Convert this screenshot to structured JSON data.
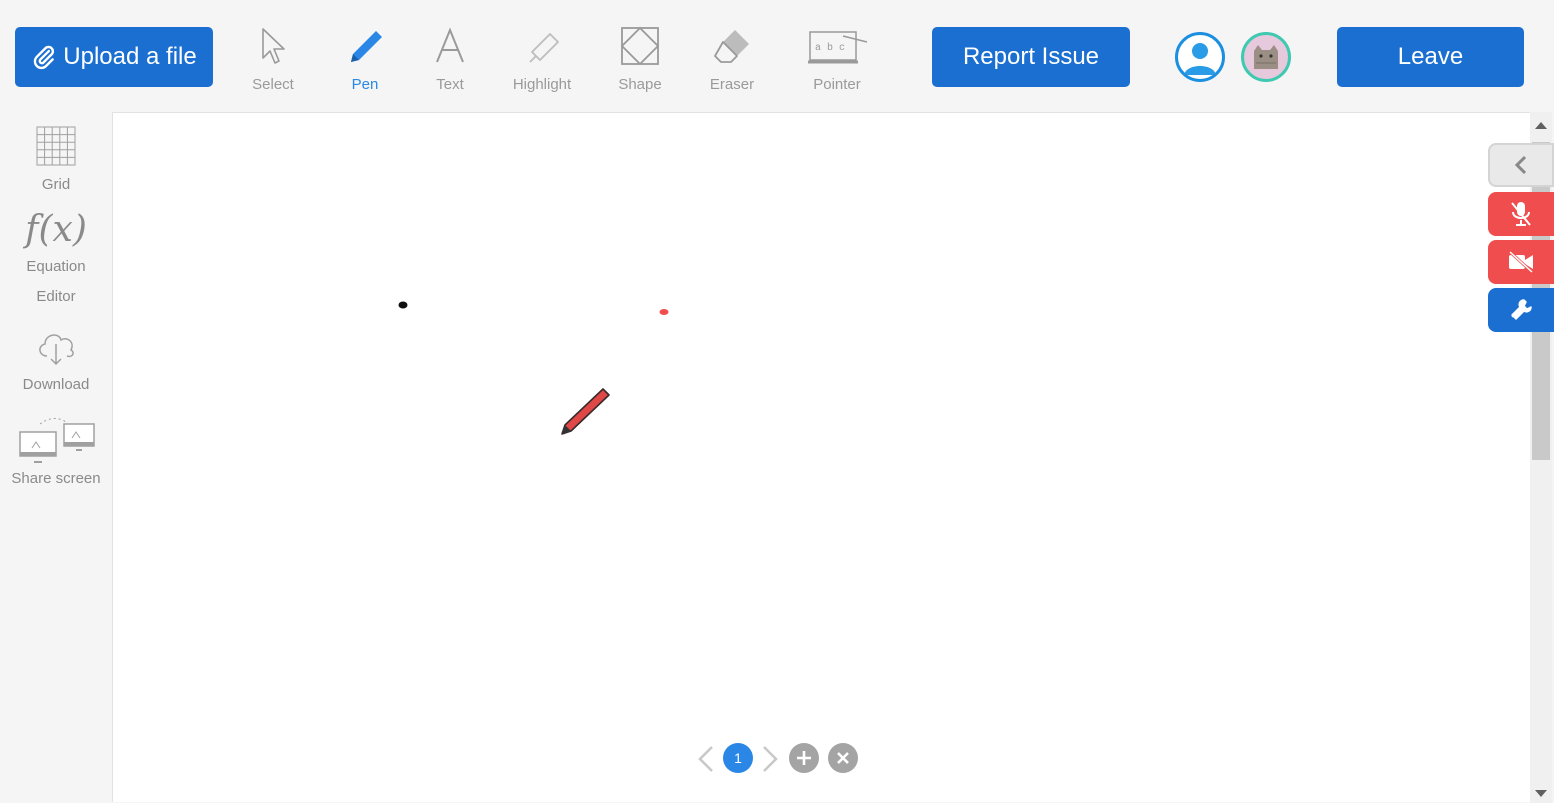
{
  "toolbar": {
    "upload_label": "Upload a file",
    "tools": [
      {
        "label": "Select",
        "icon": "cursor-arrow-icon"
      },
      {
        "label": "Pen",
        "icon": "pen-icon",
        "active": true
      },
      {
        "label": "Text",
        "icon": "text-icon"
      },
      {
        "label": "Highlight",
        "icon": "highlighter-icon"
      },
      {
        "label": "Shape",
        "icon": "shape-icon"
      },
      {
        "label": "Eraser",
        "icon": "eraser-icon"
      },
      {
        "label": "Pointer",
        "icon": "pointer-board-icon"
      }
    ],
    "report_label": "Report Issue",
    "leave_label": "Leave"
  },
  "sidebar": {
    "items": [
      {
        "label": "Grid",
        "icon": "grid-icon"
      },
      {
        "label": "Equation",
        "label2": "Editor",
        "icon": "function-icon",
        "icon_text": "f(x)"
      },
      {
        "label": "Download",
        "icon": "cloud-download-icon"
      },
      {
        "label": "Share screen",
        "icon": "share-screen-icon"
      }
    ]
  },
  "pager": {
    "current_page": "1"
  },
  "colors": {
    "primary": "#1b6fd1",
    "active_tool": "#2a87e6",
    "muted_red": "#f04e4e"
  }
}
